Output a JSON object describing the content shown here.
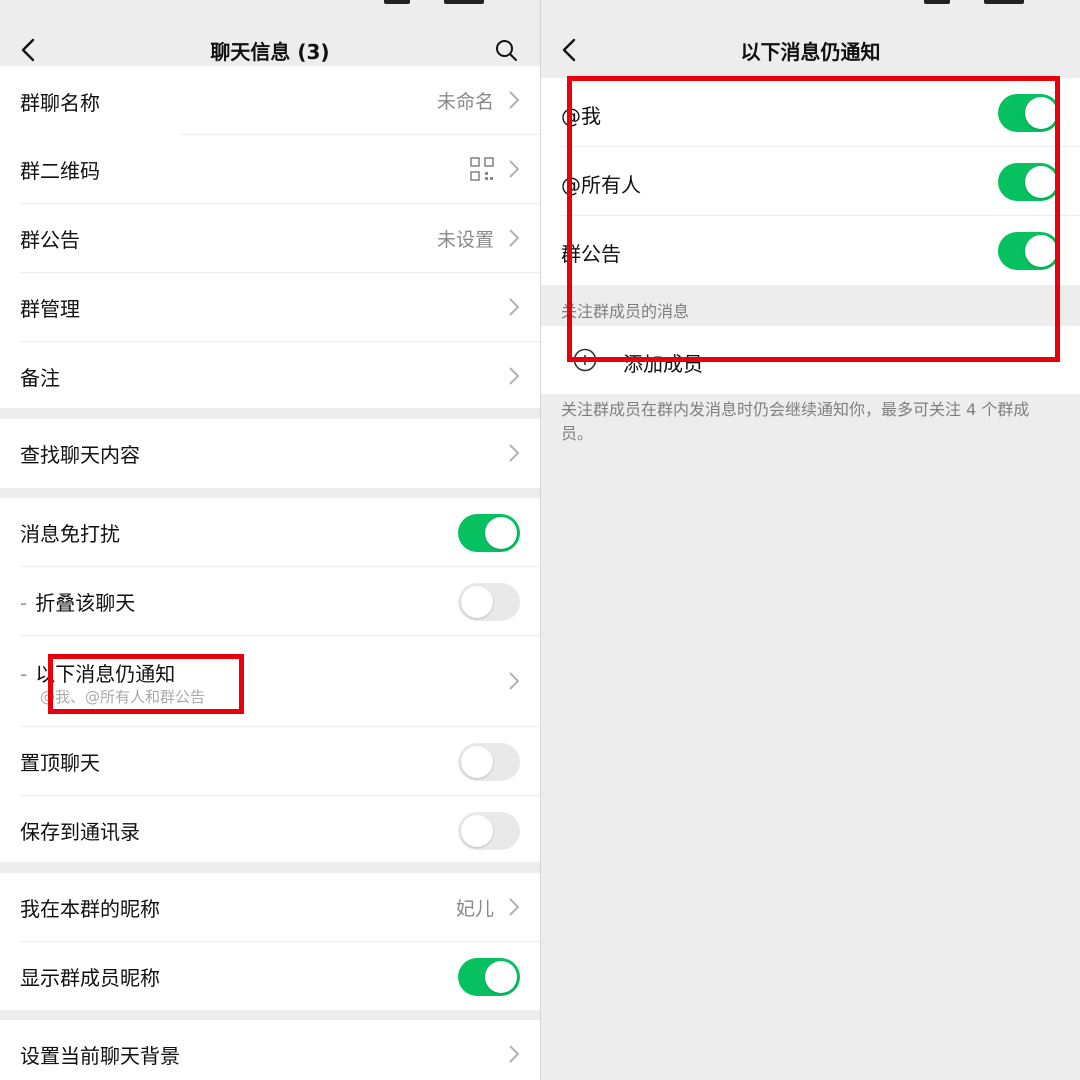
{
  "colors": {
    "accent": "#07c160",
    "highlight": "#e8000b"
  },
  "left": {
    "title": "聊天信息 (3)",
    "group1": [
      {
        "label": "群聊名称",
        "value": "未命名"
      },
      {
        "label": "群二维码",
        "icon": "qr-code-icon"
      },
      {
        "label": "群公告",
        "value": "未设置"
      },
      {
        "label": "群管理"
      },
      {
        "label": "备注"
      }
    ],
    "search_history": "查找聊天内容",
    "group3": {
      "mute": "消息免打扰",
      "fold": "折叠该聊天",
      "notify": "以下消息仍通知",
      "notify_sub": "@我、@所有人和群公告",
      "pin": "置顶聊天",
      "save_contacts": "保存到通讯录"
    },
    "group4": {
      "my_nickname": "我在本群的昵称",
      "my_nickname_value": "妃儿",
      "show_nicknames": "显示群成员昵称"
    },
    "background": "设置当前聊天背景"
  },
  "right": {
    "title": "以下消息仍通知",
    "items": [
      {
        "label": "@我",
        "on": true
      },
      {
        "label": "@所有人",
        "on": true
      },
      {
        "label": "群公告",
        "on": true
      }
    ],
    "section_caption": "关注群成员的消息",
    "add_member": "添加成员",
    "footnote": "关注群成员在群内发消息时仍会继续通知你，最多可关注 4 个群成员。"
  }
}
